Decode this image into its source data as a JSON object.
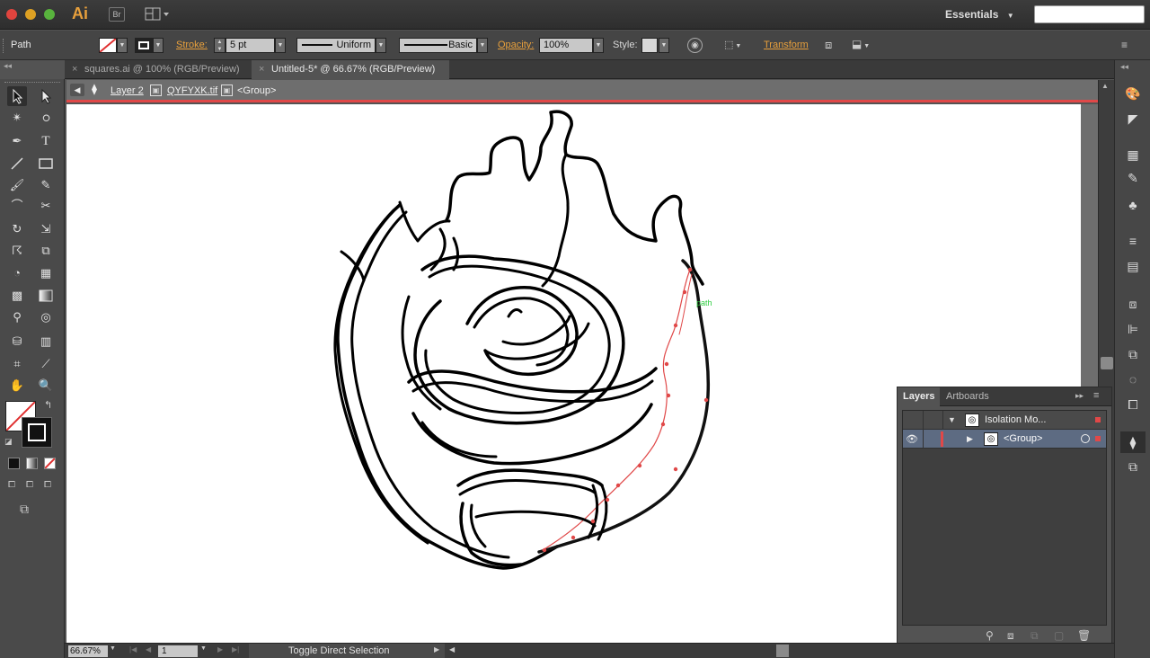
{
  "app": {
    "logo": "Ai",
    "bridge": "Br",
    "workspace": "Essentials",
    "search_placeholder": ""
  },
  "control": {
    "object_type": "Path",
    "stroke_label": "Stroke:",
    "stroke_value": "5 pt",
    "profile": "Uniform",
    "brush": "Basic",
    "opacity_label": "Opacity:",
    "opacity_value": "100%",
    "style_label": "Style:",
    "transform_label": "Transform"
  },
  "tabs": [
    {
      "label": "squares.ai @ 100% (RGB/Preview)",
      "active": false
    },
    {
      "label": "Untitled-5* @ 66.67% (RGB/Preview)",
      "active": true
    }
  ],
  "breadcrumb": {
    "layer": "Layer 2",
    "file": "QYFYXK.tif",
    "group": "<Group>"
  },
  "canvas": {
    "smart_guide_label": "path"
  },
  "layers_panel": {
    "tabs": [
      "Layers",
      "Artboards"
    ],
    "rows": [
      {
        "name": "Isolation Mo...",
        "expanded": true
      },
      {
        "name": "<Group>",
        "expanded": false
      }
    ]
  },
  "status": {
    "zoom": "66.67%",
    "artboard": "1",
    "tool_hint": "Toggle Direct Selection"
  },
  "colors": {
    "accent_orange": "#e8a03c",
    "selection_red": "#e04848",
    "smart_guide_green": "#2ecc40"
  }
}
